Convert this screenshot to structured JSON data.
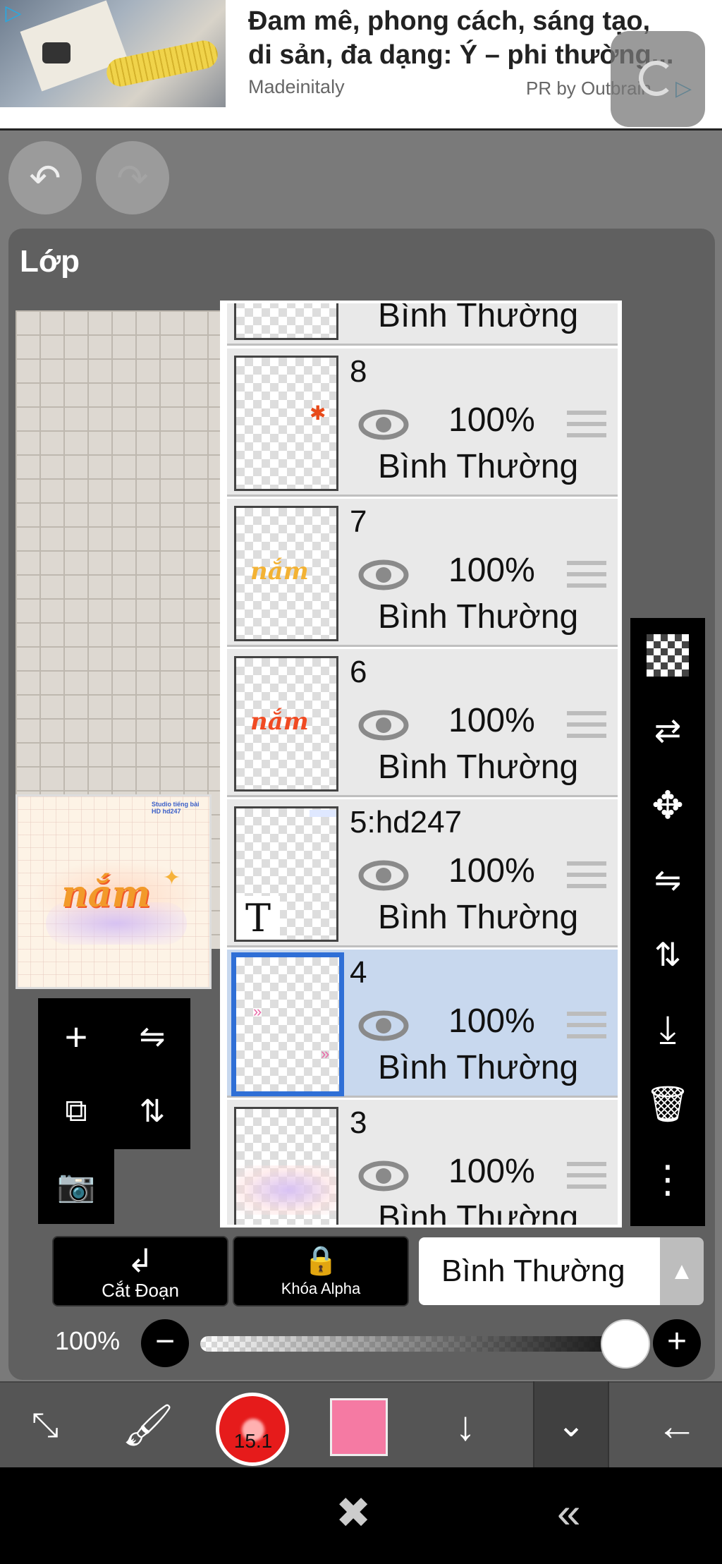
{
  "ad": {
    "title": "Đam mê, phong cách, sáng tạo, di sản, đa dạng: Ý – phi thường...",
    "title_line1": "Đam mê, phong cách, sáng tạo,",
    "title_line2": "di sản, đa dạng: Ý – phi thường...",
    "source": "Madeinitaly",
    "pr": "PR by Outbrain"
  },
  "panel": {
    "title": "Lớp"
  },
  "preview": {
    "word": "nắm",
    "tag": "Studio tiếng bài HD hd247"
  },
  "layers": [
    {
      "name": "",
      "opacity": "",
      "mode": "Bình Thường"
    },
    {
      "name": "8",
      "opacity": "100%",
      "mode": "Bình Thường"
    },
    {
      "name": "7",
      "opacity": "100%",
      "mode": "Bình Thường",
      "thumb_word": "nắm"
    },
    {
      "name": "6",
      "opacity": "100%",
      "mode": "Bình Thường",
      "thumb_word": "nắm"
    },
    {
      "name": "5:hd247",
      "opacity": "100%",
      "mode": "Bình Thường",
      "thumb_letter": "T"
    },
    {
      "name": "4",
      "opacity": "100%",
      "mode": "Bình Thường",
      "selected": true
    },
    {
      "name": "3",
      "opacity": "100%",
      "mode": "Bình Thường"
    }
  ],
  "controls": {
    "clip_label": "Cắt Đoạn",
    "alpha_lock_label": "Khóa Alpha",
    "blend_mode": "Bình Thường",
    "opacity_label": "100%",
    "opacity_value": 1.0
  },
  "toolbar": {
    "brush_size": "15.1",
    "color": "#f57aa3"
  },
  "icons": {
    "undo": "undo-icon",
    "redo": "redo-icon"
  }
}
